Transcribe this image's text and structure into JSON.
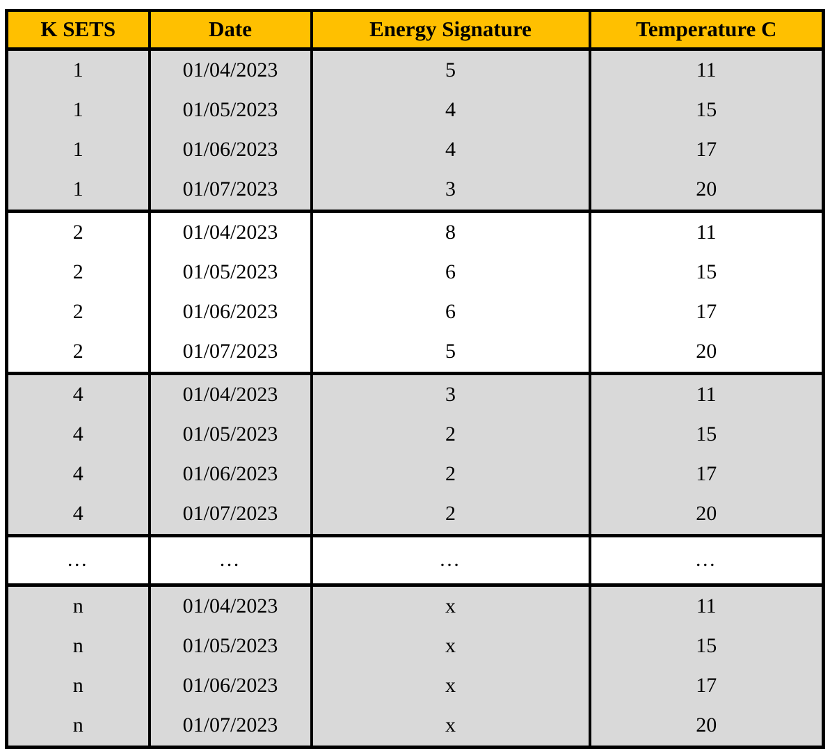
{
  "table": {
    "columns": [
      {
        "key": "kset",
        "label": "K SETS"
      },
      {
        "key": "date",
        "label": "Date"
      },
      {
        "key": "energy",
        "label": "Energy Signature"
      },
      {
        "key": "temp",
        "label": "Temperature C"
      }
    ],
    "header_background": "#FFC000",
    "shaded_row_background": "#D9D9D9",
    "plain_row_background": "#FFFFFF",
    "border_color": "#000000",
    "groups": [
      {
        "name": "k-set-1",
        "shading": "gray",
        "rows": [
          {
            "kset": "1",
            "date": "01/04/2023",
            "energy": "5",
            "temp": "11"
          },
          {
            "kset": "1",
            "date": "01/05/2023",
            "energy": "4",
            "temp": "15"
          },
          {
            "kset": "1",
            "date": "01/06/2023",
            "energy": "4",
            "temp": "17"
          },
          {
            "kset": "1",
            "date": "01/07/2023",
            "energy": "3",
            "temp": "20"
          }
        ]
      },
      {
        "name": "k-set-2",
        "shading": "white",
        "rows": [
          {
            "kset": "2",
            "date": "01/04/2023",
            "energy": "8",
            "temp": "11"
          },
          {
            "kset": "2",
            "date": "01/05/2023",
            "energy": "6",
            "temp": "15"
          },
          {
            "kset": "2",
            "date": "01/06/2023",
            "energy": "6",
            "temp": "17"
          },
          {
            "kset": "2",
            "date": "01/07/2023",
            "energy": "5",
            "temp": "20"
          }
        ]
      },
      {
        "name": "k-set-4",
        "shading": "gray",
        "rows": [
          {
            "kset": "4",
            "date": "01/04/2023",
            "energy": "3",
            "temp": "11"
          },
          {
            "kset": "4",
            "date": "01/05/2023",
            "energy": "2",
            "temp": "15"
          },
          {
            "kset": "4",
            "date": "01/06/2023",
            "energy": "2",
            "temp": "17"
          },
          {
            "kset": "4",
            "date": "01/07/2023",
            "energy": "2",
            "temp": "20"
          }
        ]
      },
      {
        "name": "continuation-ellipsis",
        "shading": "white",
        "rows": [
          {
            "kset": "…",
            "date": "…",
            "energy": "…",
            "temp": "…"
          }
        ]
      },
      {
        "name": "k-set-n",
        "shading": "gray",
        "rows": [
          {
            "kset": "n",
            "date": "01/04/2023",
            "energy": "x",
            "temp": "11"
          },
          {
            "kset": "n",
            "date": "01/05/2023",
            "energy": "x",
            "temp": "15"
          },
          {
            "kset": "n",
            "date": "01/06/2023",
            "energy": "x",
            "temp": "17"
          },
          {
            "kset": "n",
            "date": "01/07/2023",
            "energy": "x",
            "temp": "20"
          }
        ]
      }
    ]
  }
}
